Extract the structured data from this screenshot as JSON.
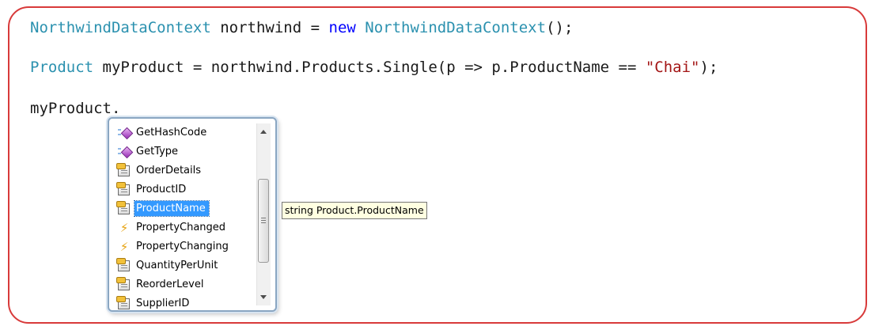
{
  "code": {
    "line1": {
      "type": "NorthwindDataContext",
      "var_part": " northwind = ",
      "keyword": "new",
      "space": " ",
      "ctor": "NorthwindDataContext",
      "tail": "();"
    },
    "line2": {
      "type": "Product",
      "mid": " myProduct = northwind.Products.Single(p => p.ProductName == ",
      "string": "\"Chai\"",
      "tail": ");"
    },
    "line3": {
      "text": "myProduct."
    }
  },
  "intellisense": {
    "items": [
      {
        "label": "GetHashCode",
        "icon": "method-icon"
      },
      {
        "label": "GetType",
        "icon": "method-icon"
      },
      {
        "label": "OrderDetails",
        "icon": "property-icon"
      },
      {
        "label": "ProductID",
        "icon": "property-icon"
      },
      {
        "label": "ProductName",
        "icon": "property-icon",
        "selected": true
      },
      {
        "label": "PropertyChanged",
        "icon": "event-icon"
      },
      {
        "label": "PropertyChanging",
        "icon": "event-icon"
      },
      {
        "label": "QuantityPerUnit",
        "icon": "property-icon"
      },
      {
        "label": "ReorderLevel",
        "icon": "property-icon"
      },
      {
        "label": "SupplierID",
        "icon": "property-icon"
      }
    ],
    "event_glyph": "⚡"
  },
  "tooltip": {
    "text": "string Product.ProductName"
  },
  "colors": {
    "type": "#2b91af",
    "keyword": "#0000ff",
    "string": "#a31515",
    "frame": "#d83a3a",
    "selection": "#3399ff",
    "tooltip_bg": "#ffffe1"
  }
}
